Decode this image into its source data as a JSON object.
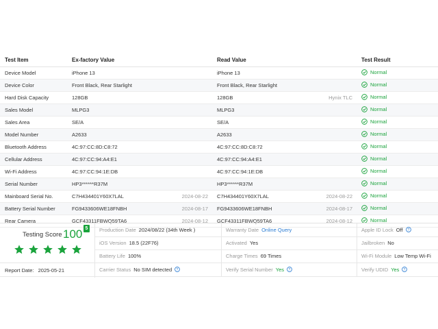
{
  "table": {
    "headers": {
      "item": "Test Item",
      "factory": "Ex-factory Value",
      "read": "Read Value",
      "result": "Test Result"
    },
    "rows": [
      {
        "item": "Device Model",
        "factory": "iPhone 13",
        "factory_date": "",
        "read": "iPhone 13",
        "read_note": "",
        "result": "Normal"
      },
      {
        "item": "Device Color",
        "factory": "Front Black, Rear Starlight",
        "factory_date": "",
        "read": "Front Black, Rear Starlight",
        "read_note": "",
        "result": "Normal"
      },
      {
        "item": "Hard Disk Capacity",
        "factory": "128GB",
        "factory_date": "",
        "read": "128GB",
        "read_note": "Hynix TLC",
        "result": "Normal"
      },
      {
        "item": "Sales Model",
        "factory": "MLPG3",
        "factory_date": "",
        "read": "MLPG3",
        "read_note": "",
        "result": "Normal"
      },
      {
        "item": "Sales Area",
        "factory": "SE/A",
        "factory_date": "",
        "read": "SE/A",
        "read_note": "",
        "result": "Normal"
      },
      {
        "item": "Model Number",
        "factory": "A2633",
        "factory_date": "",
        "read": "A2633",
        "read_note": "",
        "result": "Normal"
      },
      {
        "item": "Bluetooth Address",
        "factory": "4C:97:CC:8D:C8:72",
        "factory_date": "",
        "read": "4C:97:CC:8D:C8:72",
        "read_note": "",
        "result": "Normal"
      },
      {
        "item": "Cellular Address",
        "factory": "4C:97:CC:94:A4:E1",
        "factory_date": "",
        "read": "4C:97:CC:94:A4:E1",
        "read_note": "",
        "result": "Normal"
      },
      {
        "item": "Wi-Fi Address",
        "factory": "4C:97:CC:94:1E:DB",
        "factory_date": "",
        "read": "4C:97:CC:94:1E:DB",
        "read_note": "",
        "result": "Normal"
      },
      {
        "item": "Serial Number",
        "factory": "HP3******R37M",
        "factory_date": "",
        "read": "HP3******R37M",
        "read_note": "",
        "result": "Normal"
      },
      {
        "item": "Mainboard Serial No.",
        "factory": "C7H434401Y60X7LAL",
        "factory_date": "2024-08-22",
        "read": "C7H434401Y60X7LAL",
        "read_note": "2024-08-22",
        "result": "Normal"
      },
      {
        "item": "Battery Serial Number",
        "factory": "FG9433606WE18FNBH",
        "factory_date": "2024-08-17",
        "read": "FG9433606WE18FNBH",
        "read_note": "2024-08-17",
        "result": "Normal"
      },
      {
        "item": "Rear Camera",
        "factory": "GCF43311FBWQ59TA6",
        "factory_date": "2024-08-12",
        "read": "GCF43311FBWQ59TA6",
        "read_note": "2024-08-12",
        "result": "Normal"
      }
    ]
  },
  "summary": {
    "score_label": "Testing Score",
    "score_value": "100",
    "score_badge": "5",
    "star_rating": 5,
    "star_max": 5,
    "report_date_label": "Report Date:",
    "report_date": "2025-05-21",
    "production_date_label": "Production Date",
    "production_date": "2024/08/22 (34th Week )",
    "warranty_label": "Warranty Date",
    "warranty_value": "Online Query",
    "apple_id_label": "Apple ID Lock",
    "apple_id_value": "Off",
    "ios_label": "iOS Version",
    "ios_value": "18.5 (22F76)",
    "activated_label": "Activated",
    "activated_value": "Yes",
    "jailbroken_label": "Jailbroken",
    "jailbroken_value": "No",
    "battery_label": "Battery Life",
    "battery_value": "100%",
    "charge_label": "Charge Times",
    "charge_value": "69 Times",
    "wifi_label": "Wi-Fi Module",
    "wifi_value": "Low Temp Wi-Fi",
    "carrier_label": "Carrier Status",
    "carrier_value": "No SIM detected",
    "verify_serial_label": "Verify Serial Number",
    "verify_serial_value": "Yes",
    "verify_udid_label": "Verify UDID",
    "verify_udid_value": "Yes"
  },
  "colors": {
    "accent_green": "#1aa33c",
    "link_blue": "#2b7cd3",
    "alt_row": "#f6f7f9"
  },
  "icons": {
    "result": "check-circle-icon",
    "star": "star-icon",
    "info": "info-icon"
  }
}
